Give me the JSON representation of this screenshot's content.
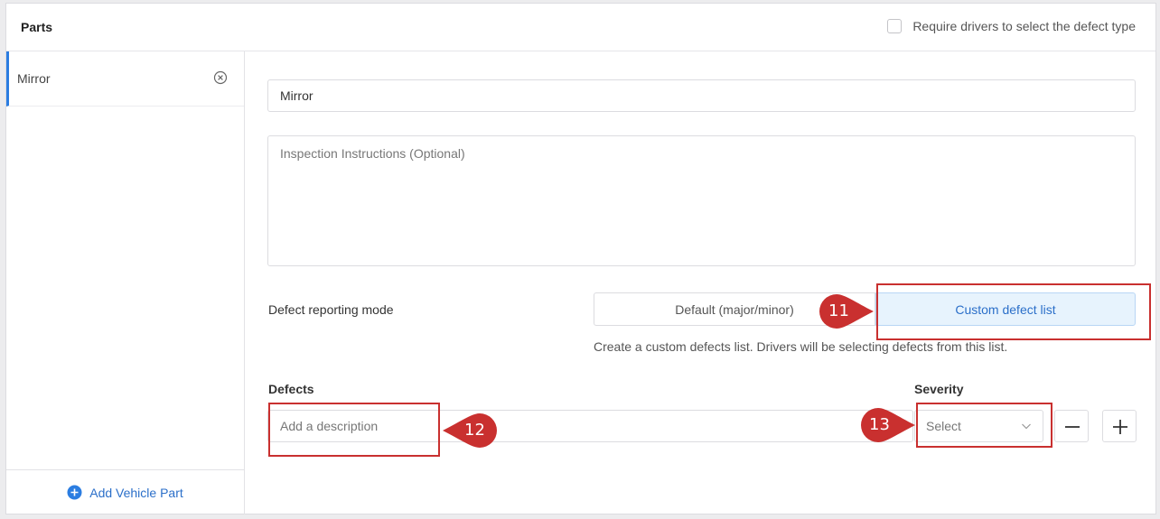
{
  "header": {
    "title": "Parts",
    "require_label": "Require drivers to select the defect type",
    "require_checked": false
  },
  "sidebar": {
    "items": [
      {
        "label": "Mirror",
        "remove_icon": "close-circle-icon",
        "selected": true
      }
    ],
    "add_label": "Add Vehicle Part",
    "add_icon": "plus-circle-icon"
  },
  "form": {
    "part_name": "Mirror",
    "instructions_placeholder": "Inspection Instructions (Optional)",
    "mode_label": "Defect reporting mode",
    "mode_options": [
      "Default (major/minor)",
      "Custom defect list"
    ],
    "mode_selected": "Custom defect list",
    "mode_hint": "Create a custom defects list. Drivers will be selecting defects from this list.",
    "defects_label": "Defects",
    "defect_placeholder": "Add a description",
    "severity_label": "Severity",
    "severity_value": "Select"
  },
  "callouts": [
    "11",
    "12",
    "13"
  ],
  "colors": {
    "accent": "#2b6fc9",
    "selected_bg": "#e7f3fd",
    "callout": "#c9302f"
  }
}
